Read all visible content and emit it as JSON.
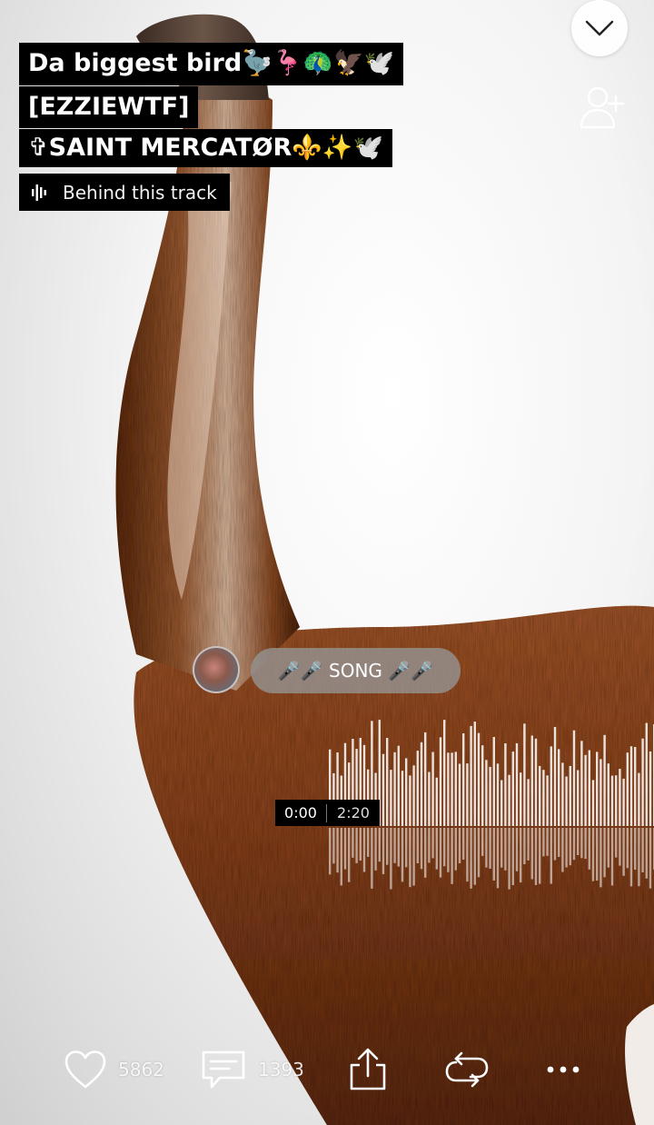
{
  "track": {
    "title": "Da biggest bird🦤🦩🦚🦅🕊️",
    "artist_tag": "[EZZIEWTF]",
    "uploader": "✞SAINT MERCATØR⚜️✨🕊️",
    "behind_label": "Behind this track"
  },
  "comment": {
    "text": "🎤🎤 SONG 🎤🎤",
    "avatar_icon": "user-avatar"
  },
  "player": {
    "current_time": "0:00",
    "total_time": "2:20",
    "waveform_color": "#ffffff"
  },
  "actions": {
    "likes": "5862",
    "comments": "1393",
    "like_icon": "heart-icon",
    "comment_icon": "comment-icon",
    "share_icon": "share-icon",
    "repost_icon": "repost-icon",
    "more_icon": "more-icon"
  },
  "top_controls": {
    "collapse_icon": "chevron-down-icon",
    "follow_icon": "add-user-icon"
  },
  "colors": {
    "title_bg": "#000000",
    "title_text": "#ffffff",
    "bird_brown": "#8a4a22"
  }
}
